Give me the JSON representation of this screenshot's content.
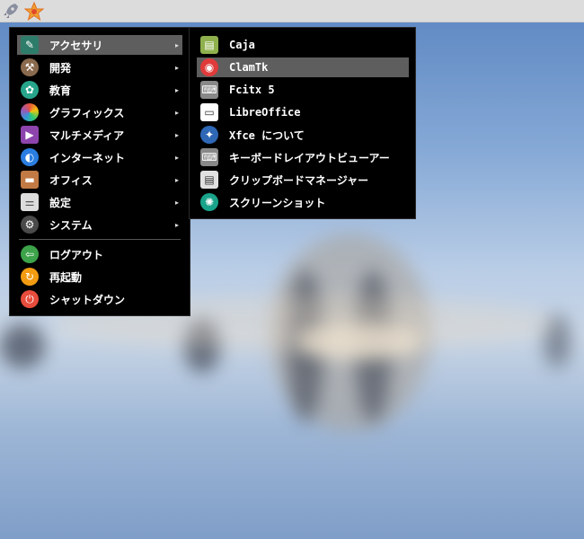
{
  "panel": {
    "launcher_icon": "rocket-icon",
    "favorites_icon": "star-icon"
  },
  "main_menu": {
    "items": [
      {
        "label": "アクセサリ",
        "icon": "accessories-icon",
        "color": "#2e7d6a",
        "has_submenu": true,
        "highlighted": true
      },
      {
        "label": "開発",
        "icon": "hammer-icon",
        "color": "#8a6a4e",
        "has_submenu": true
      },
      {
        "label": "教育",
        "icon": "education-icon",
        "color": "#27a58b",
        "has_submenu": true
      },
      {
        "label": "グラフィックス",
        "icon": "graphics-icon",
        "color": "#e8533c",
        "has_submenu": true
      },
      {
        "label": "マルチメディア",
        "icon": "multimedia-icon",
        "color": "#8e44ad",
        "has_submenu": true
      },
      {
        "label": "インターネット",
        "icon": "globe-icon",
        "color": "#2a7de1",
        "has_submenu": true
      },
      {
        "label": "オフィス",
        "icon": "briefcase-icon",
        "color": "#c27a45",
        "has_submenu": true
      },
      {
        "label": "設定",
        "icon": "settings-icon",
        "color": "#dcdcdc",
        "has_submenu": true
      },
      {
        "label": "システム",
        "icon": "gear-icon",
        "color": "#4a4a4a",
        "has_submenu": true
      }
    ],
    "session": [
      {
        "label": "ログアウト",
        "icon": "logout-icon",
        "color": "#3da34a"
      },
      {
        "label": "再起動",
        "icon": "reboot-icon",
        "color": "#f39c12"
      },
      {
        "label": "シャットダウン",
        "icon": "power-icon",
        "color": "#e74c3c"
      }
    ],
    "submenu_arrow": "▸"
  },
  "sub_menu": {
    "items": [
      {
        "label": "Caja",
        "icon": "file-manager-icon",
        "color": "#8fb04d"
      },
      {
        "label": "ClamTk",
        "icon": "clamtk-icon",
        "color": "#e03a3a",
        "highlighted": true
      },
      {
        "label": "Fcitx 5",
        "icon": "keyboard-icon",
        "color": "#888888"
      },
      {
        "label": "LibreOffice",
        "icon": "document-icon",
        "color": "#ffffff"
      },
      {
        "label": "Xfce について",
        "icon": "xfce-icon",
        "color": "#2e67b5"
      },
      {
        "label": "キーボードレイアウトビューアー",
        "icon": "keyboard-layout-icon",
        "color": "#888888"
      },
      {
        "label": "クリップボードマネージャー",
        "icon": "clipboard-icon",
        "color": "#e0e0e0"
      },
      {
        "label": "スクリーンショット",
        "icon": "screenshot-icon",
        "color": "#1aa38b"
      }
    ]
  }
}
